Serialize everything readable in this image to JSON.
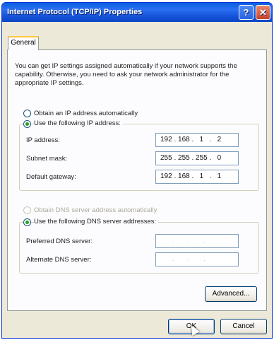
{
  "window": {
    "title": "Internet Protocol (TCP/IP) Properties",
    "help_glyph": "?",
    "close_glyph": "✕"
  },
  "tabs": [
    {
      "label": "General",
      "selected": true
    }
  ],
  "intro_text": "You can get IP settings assigned automatically if your network supports the capability. Otherwise, you need to ask your network administrator for the appropriate IP settings.",
  "ip_section": {
    "auto_label": "Obtain an IP address automatically",
    "auto_selected": false,
    "manual_label": "Use the following IP address:",
    "manual_selected": true,
    "fields": [
      {
        "label": "IP address:",
        "value": "192 . 168 .   1   .   2"
      },
      {
        "label": "Subnet mask:",
        "value": "255 . 255 . 255 .   0"
      },
      {
        "label": "Default gateway:",
        "value": "192 . 168 .   1   .   1"
      }
    ]
  },
  "dns_section": {
    "auto_label": "Obtain DNS server address automatically",
    "auto_enabled": false,
    "manual_label": "Use the following DNS server addresses:",
    "manual_selected": true,
    "fields": [
      {
        "label": "Preferred DNS server:",
        "value": "      .       .       .    "
      },
      {
        "label": "Alternate DNS server:",
        "value": "      .       .       .    "
      }
    ]
  },
  "buttons": {
    "advanced": "Advanced...",
    "ok": "OK",
    "cancel": "Cancel"
  },
  "colors": {
    "titlebar": "#0a5fe0",
    "dialog_bg": "#ece9d8",
    "panel_bg": "#fcfcfe",
    "radio_dot": "#21a121"
  }
}
